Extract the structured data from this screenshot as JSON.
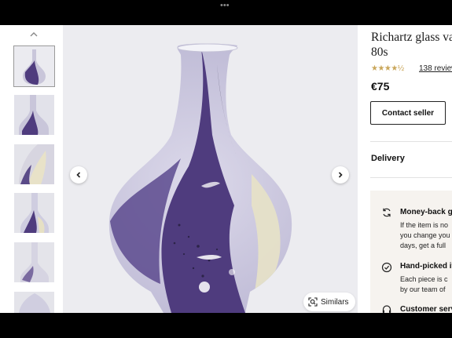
{
  "window": {
    "dots": "•••"
  },
  "gallery": {
    "thumbnail_count": 6,
    "similars_label": "Similars"
  },
  "product": {
    "title": "Richartz glass va\n80s",
    "rating_stars": "★★★★½",
    "rating_value": 4.5,
    "reviews": "138 review",
    "price": "€75",
    "contact_label": "Contact seller"
  },
  "delivery": {
    "label": "Delivery"
  },
  "promo": {
    "items": [
      {
        "icon": "refresh-icon",
        "title": "Money-back g",
        "text": "If the item is no\nyou change you\ndays, get a full"
      },
      {
        "icon": "check-circle-icon",
        "title": "Hand-picked it",
        "text": "Each piece is c\nby our team of"
      },
      {
        "icon": "headset-icon",
        "title": "Customer serv",
        "text": ""
      }
    ]
  },
  "colors": {
    "accent_purple": "#4f3c7e",
    "star_gold": "#c9a65a",
    "promo_bg": "#f6f3ef"
  }
}
